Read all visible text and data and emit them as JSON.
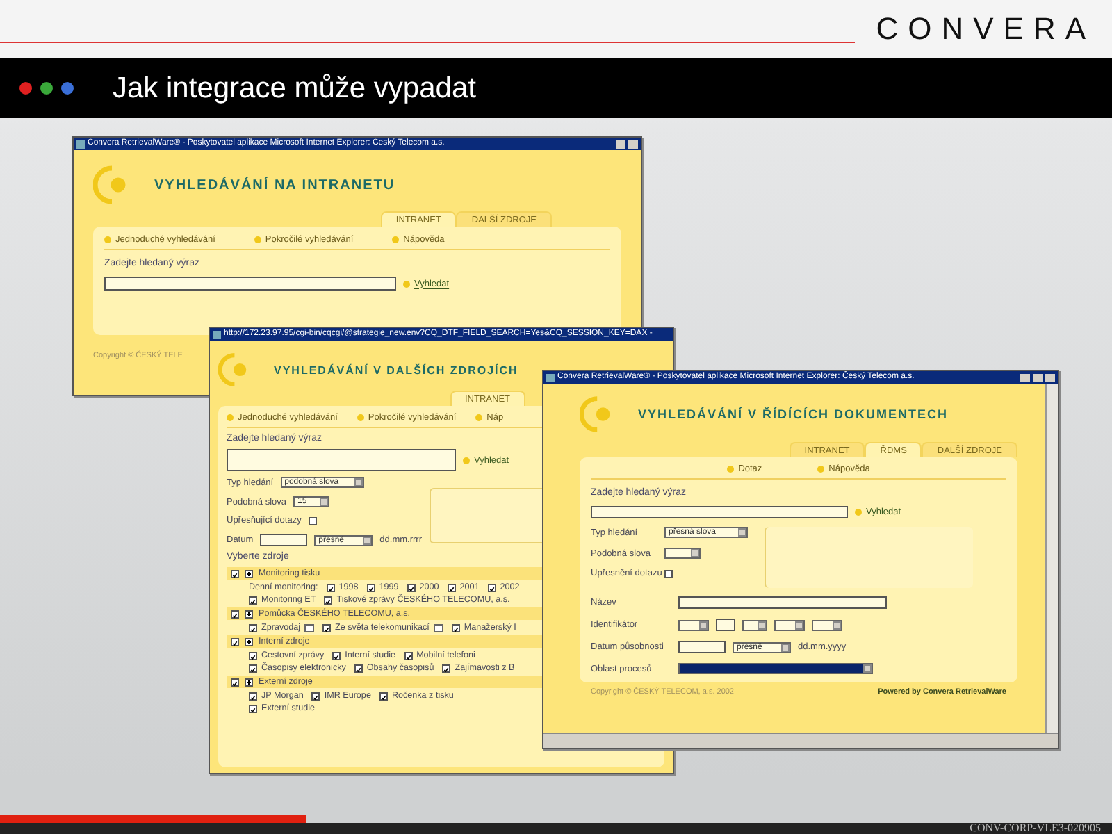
{
  "logo": {
    "text": "CONVERA"
  },
  "slide_title": "Jak integrace může vypadat",
  "dots": [
    {
      "color": "#e02020"
    },
    {
      "color": "#3aa83a"
    },
    {
      "color": "#3a6fd8"
    }
  ],
  "footer_code": "CONV-CORP-VLE3-020905",
  "window_intranet": {
    "title": "Convera RetrievalWare® - Poskytovatel aplikace Microsoft Internet Explorer: Český Telecom a.s.",
    "heading": "VYHLEDÁVÁNÍ NA INTRANETU",
    "tabs": [
      {
        "label": "INTRANET",
        "selected": true
      },
      {
        "label": "DALŠÍ ZDROJE",
        "selected": false
      }
    ],
    "links": [
      "Jednoduché vyhledávání",
      "Pokročilé vyhledávání",
      "Nápověda"
    ],
    "prompt": "Zadejte hledaný výraz",
    "search_button": "Vyhledat",
    "copyright": "Copyright © ČESKÝ TELE"
  },
  "window_sources": {
    "title": "http://172.23.97.95/cgi-bin/cqcgi/@strategie_new.env?CQ_DTF_FIELD_SEARCH=Yes&CQ_SESSION_KEY=DAX -",
    "heading": "VYHLEDÁVÁNÍ V DALŠÍCH ZDROJÍCH",
    "tabs": [
      {
        "label": "INTRANET",
        "selected": true
      }
    ],
    "links": [
      "Jednoduché vyhledávání",
      "Pokročilé vyhledávání",
      "Náp"
    ],
    "prompt": "Zadejte hledaný výraz",
    "search_button": "Vyhledat",
    "form": [
      {
        "kind": "select",
        "label": "Typ hledání",
        "value": "podobná slova"
      },
      {
        "kind": "select",
        "label": "Podobná slova",
        "value": "15"
      },
      {
        "kind": "checkbox",
        "label": "Upřesňující dotazy",
        "checked": false
      },
      {
        "kind": "date",
        "label": "Datum",
        "value": "přesně",
        "hint": "dd.mm.rrrr"
      }
    ],
    "sources_title": "Vyberte zdroje",
    "sources": [
      {
        "label": "Monitoring tisku",
        "checked": true,
        "rows": [
          [
            {
              "kind": "text",
              "label": "Denní monitoring:"
            },
            {
              "kind": "checkbox",
              "label": "1998",
              "checked": true
            },
            {
              "kind": "checkbox",
              "label": "1999",
              "checked": true
            },
            {
              "kind": "checkbox",
              "label": "2000",
              "checked": true
            },
            {
              "kind": "checkbox",
              "label": "2001",
              "checked": true
            },
            {
              "kind": "checkbox",
              "label": "2002",
              "checked": true
            }
          ],
          [
            {
              "kind": "checkbox",
              "label": "Monitoring ET",
              "checked": true
            },
            {
              "kind": "checkbox",
              "label": "Tiskové zprávy ČESKÉHO TELECOMU, a.s.",
              "checked": true
            }
          ]
        ]
      },
      {
        "label": "Pomůcka ČESKÉHO TELECOMU, a.s.",
        "checked": true,
        "rows": [
          [
            {
              "kind": "checkbox",
              "label": "Zpravodaj",
              "checked": true,
              "note_icon": true
            },
            {
              "kind": "checkbox",
              "label": "Ze světa telekomunikací",
              "checked": true,
              "note_icon": true
            },
            {
              "kind": "checkbox",
              "label": "Manažerský I",
              "checked": true
            }
          ]
        ]
      },
      {
        "label": "Interní zdroje",
        "checked": true,
        "rows": [
          [
            {
              "kind": "checkbox",
              "label": "Cestovní zprávy",
              "checked": true
            },
            {
              "kind": "checkbox",
              "label": "Interní studie",
              "checked": true
            },
            {
              "kind": "checkbox",
              "label": "Mobilní telefoni",
              "checked": true
            }
          ],
          [
            {
              "kind": "checkbox",
              "label": "Časopisy elektronicky",
              "checked": true
            },
            {
              "kind": "checkbox",
              "label": "Obsahy časopisů",
              "checked": true
            },
            {
              "kind": "checkbox",
              "label": "Zajímavosti z B",
              "checked": true
            }
          ]
        ]
      },
      {
        "label": "Externí zdroje",
        "checked": true,
        "rows": [
          [
            {
              "kind": "checkbox",
              "label": "JP Morgan",
              "checked": true
            },
            {
              "kind": "checkbox",
              "label": "IMR Europe",
              "checked": true
            },
            {
              "kind": "checkbox",
              "label": "Ročenka z tisku",
              "checked": true
            }
          ],
          [
            {
              "kind": "checkbox",
              "label": "Externí studie",
              "checked": true
            }
          ]
        ]
      }
    ]
  },
  "window_rdms": {
    "title": "Convera RetrievalWare® - Poskytovatel aplikace Microsoft Internet Explorer: Český Telecom a.s.",
    "heading": "VYHLEDÁVÁNÍ V ŘÍDÍCÍCH DOKUMENTECH",
    "tabs": [
      {
        "label": "INTRANET",
        "selected": false
      },
      {
        "label": "ŘDMS",
        "selected": true
      },
      {
        "label": "DALŠÍ ZDROJE",
        "selected": false
      }
    ],
    "links": [
      "Dotaz",
      "Nápověda"
    ],
    "prompt": "Zadejte hledaný výraz",
    "search_button": "Vyhledat",
    "form": [
      {
        "kind": "select",
        "label": "Typ hledání",
        "value": "přesná slova"
      },
      {
        "kind": "select",
        "label": "Podobná slova"
      },
      {
        "kind": "checkbox",
        "label": "Upřesnění dotazu",
        "checked": false
      },
      {
        "kind": "field",
        "label": "Název"
      },
      {
        "kind": "selects",
        "label": "Identifikátor"
      },
      {
        "kind": "date",
        "label": "Datum působnosti",
        "value": "přesně",
        "hint": "dd.mm.yyyy"
      },
      {
        "kind": "process",
        "label": "Oblast procesů",
        "highlighted": true
      }
    ],
    "copyright": "Copyright © ČESKÝ TELECOM, a.s. 2002",
    "powered_by": "Powered by Convera RetrievalWare"
  }
}
